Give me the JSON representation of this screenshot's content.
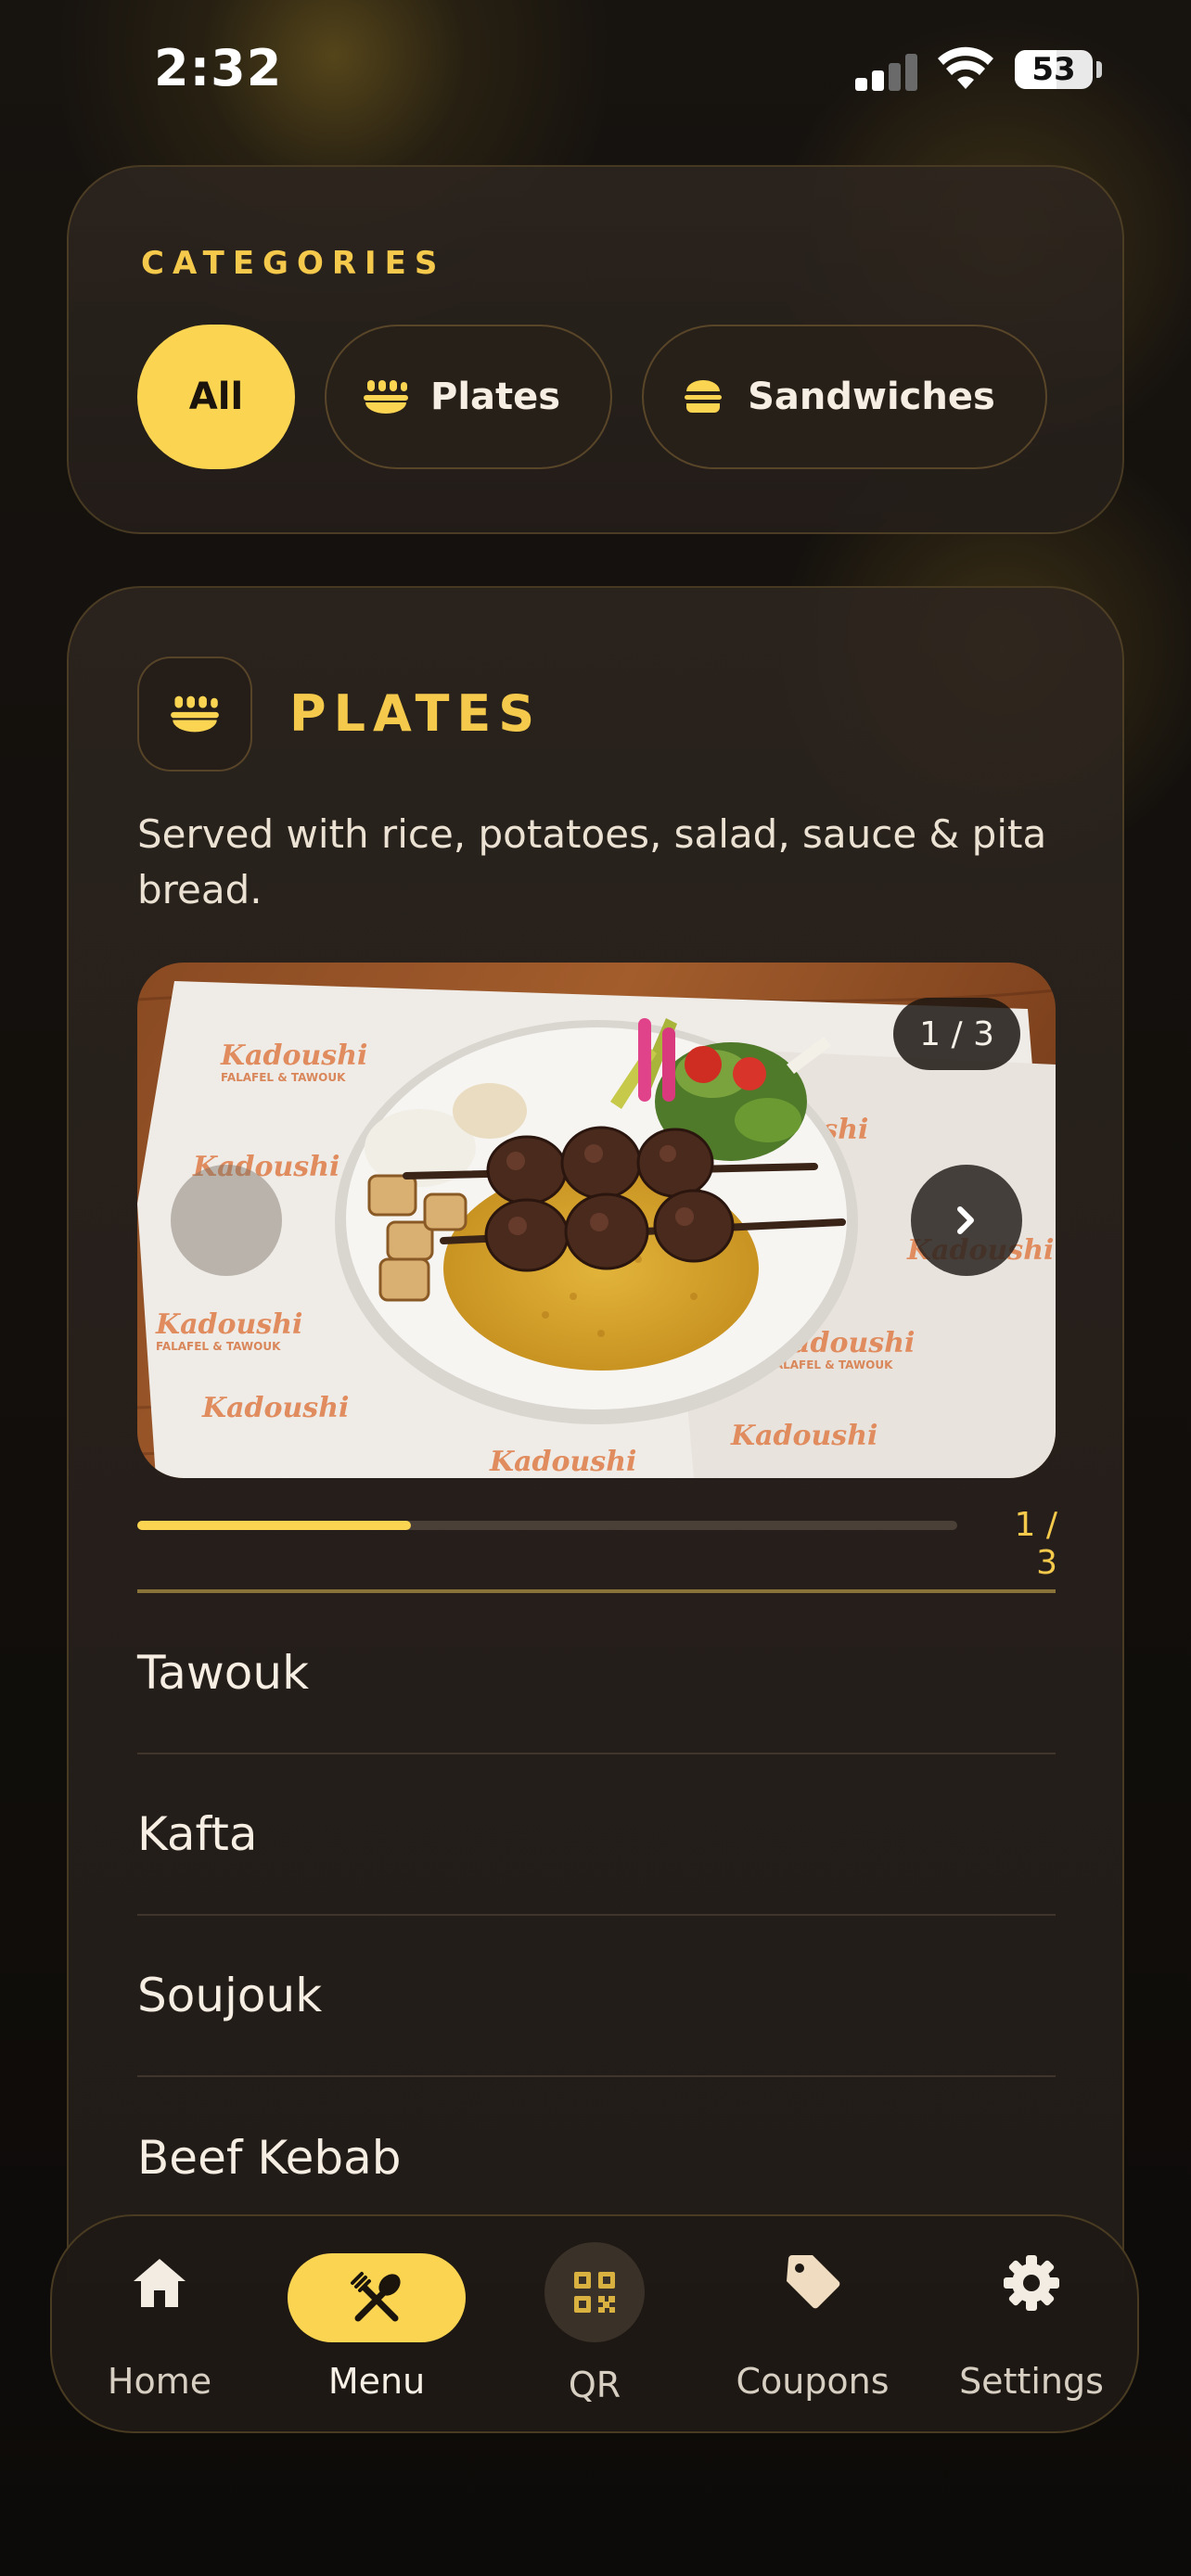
{
  "status_bar": {
    "time": "2:32",
    "battery": "53",
    "battery_level": 0.53
  },
  "categories": {
    "title": "CATEGORIES",
    "chips": [
      {
        "label": "All",
        "active": true
      },
      {
        "label": "Plates",
        "icon": "plates-icon",
        "active": false
      },
      {
        "label": "Sandwiches",
        "icon": "burger-icon",
        "active": false
      }
    ]
  },
  "section": {
    "title": "PLATES",
    "description": "Served with rice, potatoes, salad, sauce & pita bread.",
    "carousel": {
      "badge": "1 / 3",
      "progress_label": "1 / 3",
      "progress": 0.3333,
      "image_alt": "Beef kebab plate with rice, potatoes and salad on branded paper",
      "paper_brand_text": "Kadoushi",
      "paper_sub_text": "FALAFEL & TAWOUK"
    },
    "items": [
      "Tawouk",
      "Kafta",
      "Soujouk",
      "Beef Kebab"
    ]
  },
  "tabbar": {
    "tabs": [
      {
        "label": "Home",
        "icon": "home-icon"
      },
      {
        "label": "Menu",
        "icon": "utensils-icon",
        "active": true
      },
      {
        "label": "QR",
        "icon": "qr-code-icon"
      },
      {
        "label": "Coupons",
        "icon": "tag-icon"
      },
      {
        "label": "Settings",
        "icon": "gear-icon"
      }
    ]
  },
  "colors": {
    "accent": "#fbd452",
    "gold_text": "#f5c94b",
    "background": "#0f0c0a",
    "card": "#2a221d"
  }
}
